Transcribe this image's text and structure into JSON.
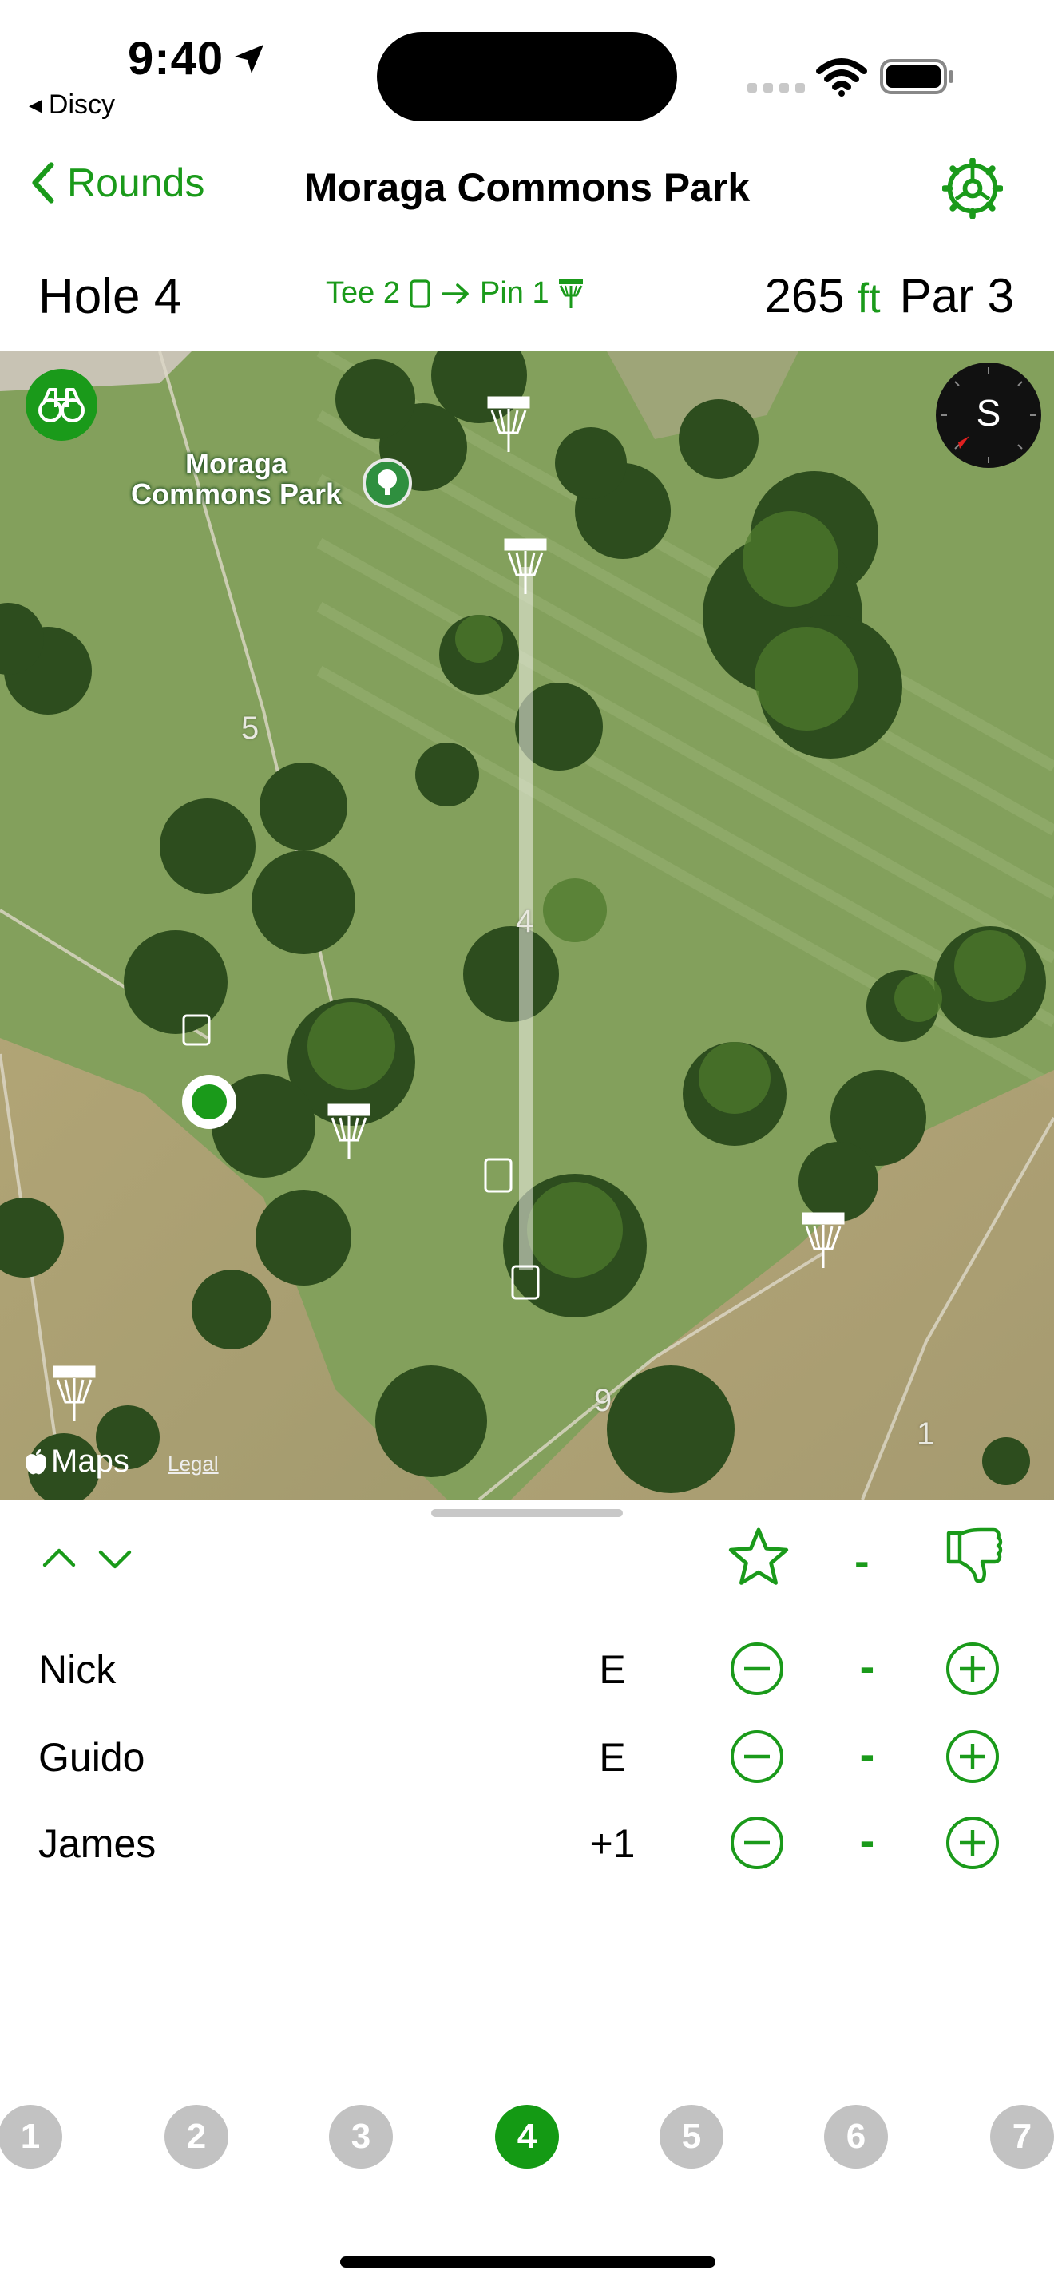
{
  "status_bar": {
    "time": "9:40",
    "back_app": "Discy"
  },
  "nav": {
    "back_label": "Rounds",
    "title": "Moraga Commons Park"
  },
  "hole_info": {
    "hole_label": "Hole 4",
    "tee_label": "Tee 2",
    "pin_label": "Pin 1",
    "distance": "265",
    "distance_unit": "ft",
    "par_label": "Par 3"
  },
  "map": {
    "park_name_line1": "Moraga",
    "park_name_line2": "Commons Park",
    "compass_heading": "S",
    "hole_numbers": [
      "5",
      "4",
      "9",
      "1"
    ],
    "maps_label": "Maps",
    "legal_label": "Legal"
  },
  "sheet": {
    "hole_rating_value": "-",
    "players": [
      {
        "name": "Nick",
        "score": "E",
        "strokes": "-"
      },
      {
        "name": "Guido",
        "score": "E",
        "strokes": "-"
      },
      {
        "name": "James",
        "score": "+1",
        "strokes": "-"
      }
    ]
  },
  "holes": {
    "items": [
      "1",
      "2",
      "3",
      "4",
      "5",
      "6",
      "7"
    ],
    "active_index": 3
  },
  "colors": {
    "accent": "#1a9a1a",
    "inactive_hole": "#c2c2c2"
  },
  "icons": [
    "location-arrow-icon",
    "wifi-icon",
    "battery-icon",
    "chevron-left-icon",
    "gear-icon",
    "tee-icon",
    "arrow-right-icon",
    "basket-icon",
    "binoculars-icon",
    "compass-icon",
    "tree-icon",
    "apple-icon",
    "chevron-up-icon",
    "chevron-down-icon",
    "star-icon",
    "thumbs-down-icon",
    "minus-circle-icon",
    "plus-circle-icon"
  ]
}
